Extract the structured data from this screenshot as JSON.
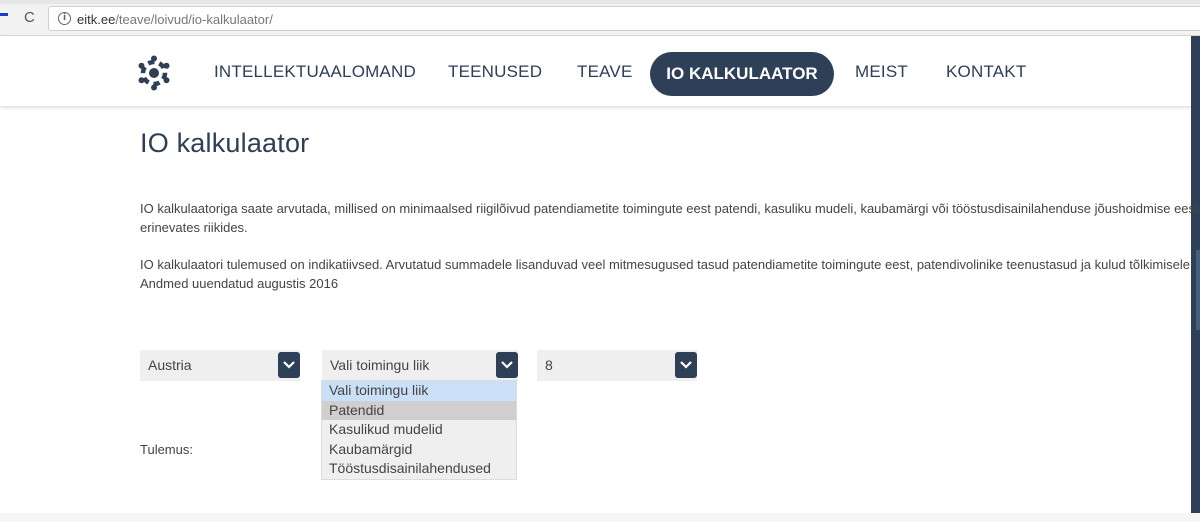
{
  "browser": {
    "url_host": "eitk.ee",
    "url_path": "/teave/loivud/io-kalkulaator/",
    "reload_glyph": "C",
    "info_glyph": "i"
  },
  "nav": {
    "items": [
      "INTELLEKTUAALOMAND",
      "TEENUSED",
      "TEAVE",
      "IO KALKULAATOR",
      "MEIST",
      "KONTAKT"
    ],
    "active": "IO KALKULAATOR",
    "accent_color": "#2e4057"
  },
  "content": {
    "title": "IO kalkulaator",
    "para1_line1": "IO kalkulaatoriga saate arvutada, millised on minimaalsed riigilõivud patendiametite toimingute eest patendi, kasuliku mudeli, kaubamärgi või tööstusdisainilahenduse jõushoidmise eest",
    "para1_line2": "erinevates riikides.",
    "para2_line1": "IO kalkulaatori tulemused on indikatiivsed. Arvutatud summadele lisanduvad veel mitmesugused tasud patendiametite toimingute eest, patendivolinike teenustasud ja kulud tõlkimisele.",
    "para2_line2": "Andmed uuendatud augustis 2016"
  },
  "form": {
    "country_value": "Austria",
    "type_value": "Vali toimingu liik",
    "year_value": "8",
    "type_options": [
      "Vali toimingu liik",
      "Patendid",
      "Kasulikud mudelid",
      "Kaubamärgid",
      "Tööstusdisainilahendused"
    ],
    "highlighted_option": "Vali toimingu liik",
    "hovered_option": "Patendid",
    "result_label": "Tulemus:"
  }
}
